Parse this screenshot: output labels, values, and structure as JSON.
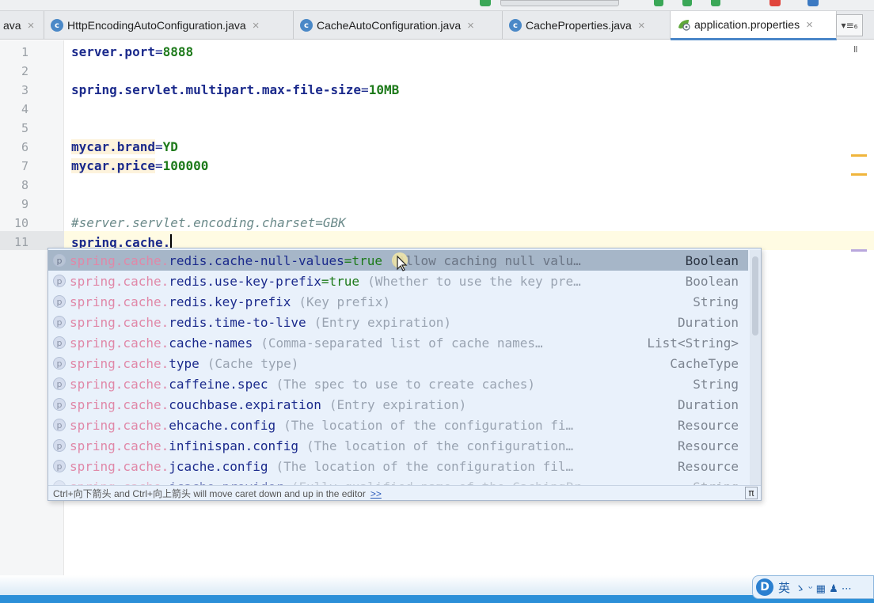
{
  "tabs": [
    {
      "label": "ava",
      "icon": "none",
      "active": false,
      "closable": true
    },
    {
      "label": "HttpEncodingAutoConfiguration.java",
      "icon": "class-icon",
      "active": false,
      "closable": true
    },
    {
      "label": "CacheAutoConfiguration.java",
      "icon": "class-icon",
      "active": false,
      "closable": true
    },
    {
      "label": "CacheProperties.java",
      "icon": "class-icon",
      "active": false,
      "closable": true
    },
    {
      "label": "application.properties",
      "icon": "spring-leaf-icon",
      "active": true,
      "closable": true
    }
  ],
  "tab_class_letter": "c",
  "tab_close_glyph": "×",
  "tab_menu_label": "▾≡₆",
  "editor": {
    "line_numbers": [
      "1",
      "2",
      "3",
      "4",
      "5",
      "6",
      "7",
      "8",
      "9",
      "10",
      "11"
    ],
    "lines": [
      {
        "key": "server.port",
        "eq": "=",
        "value": "8888"
      },
      {
        "key": "spring.servlet.multipart.max-file-size",
        "eq": "=",
        "value": "10MB"
      },
      {
        "key": "mycar.brand",
        "eq": "=",
        "value": "YD"
      },
      {
        "key": "mycar.price",
        "eq": "=",
        "value": "100000"
      },
      {
        "comment": "#server.servlet.encoding.charset=GBK"
      },
      {
        "typed": "spring.cache."
      }
    ],
    "pause_glyph": "II"
  },
  "completion": {
    "prefix": "spring.cache.",
    "badge": "p",
    "items": [
      {
        "prop": "redis.cache-null-values",
        "default": "=true",
        "desc": "(Allow caching null valu…",
        "type": "Boolean",
        "selected": true
      },
      {
        "prop": "redis.use-key-prefix",
        "default": "=true",
        "desc": "(Whether to use the key pre…",
        "type": "Boolean"
      },
      {
        "prop": "redis.key-prefix",
        "default": "",
        "desc": "(Key prefix)",
        "type": "String"
      },
      {
        "prop": "redis.time-to-live",
        "default": "",
        "desc": "(Entry expiration)",
        "type": "Duration"
      },
      {
        "prop": "cache-names",
        "default": "",
        "desc": "(Comma-separated list of cache names…",
        "type": "List<String>"
      },
      {
        "prop": "type",
        "default": "",
        "desc": "(Cache type)",
        "type": "CacheType"
      },
      {
        "prop": "caffeine.spec",
        "default": "",
        "desc": "(The spec to use to create caches)",
        "type": "String"
      },
      {
        "prop": "couchbase.expiration",
        "default": "",
        "desc": "(Entry expiration)",
        "type": "Duration"
      },
      {
        "prop": "ehcache.config",
        "default": "",
        "desc": "(The location of the configuration fi…",
        "type": "Resource"
      },
      {
        "prop": "infinispan.config",
        "default": "",
        "desc": "(The location of the configuration…",
        "type": "Resource"
      },
      {
        "prop": "jcache.config",
        "default": "",
        "desc": "(The location of the configuration fil…",
        "type": "Resource"
      },
      {
        "prop": "jcache.provider",
        "default": "",
        "desc": "(Fully qualified name of the CachingPr…",
        "type": "String",
        "partial": true
      }
    ],
    "footer_hint": "Ctrl+向下箭头 and Ctrl+向上箭头 will move caret down and up in the editor",
    "footer_more": ">>",
    "footer_pi": "π"
  },
  "ime": {
    "logo": "D",
    "lang": "英",
    "icons": "ゝ ᵕ ▦ ♟ ⋯"
  },
  "colors": {
    "accent": "#4a86c8",
    "keyword": "#1b2a8c",
    "value": "#1d7a1a",
    "comment": "#6b8a8a",
    "popup_bg": "#e9f1fb",
    "selected_row": "#a6b6c8",
    "prefix": "#e088a8",
    "taskbar": "#2b8fd8"
  }
}
